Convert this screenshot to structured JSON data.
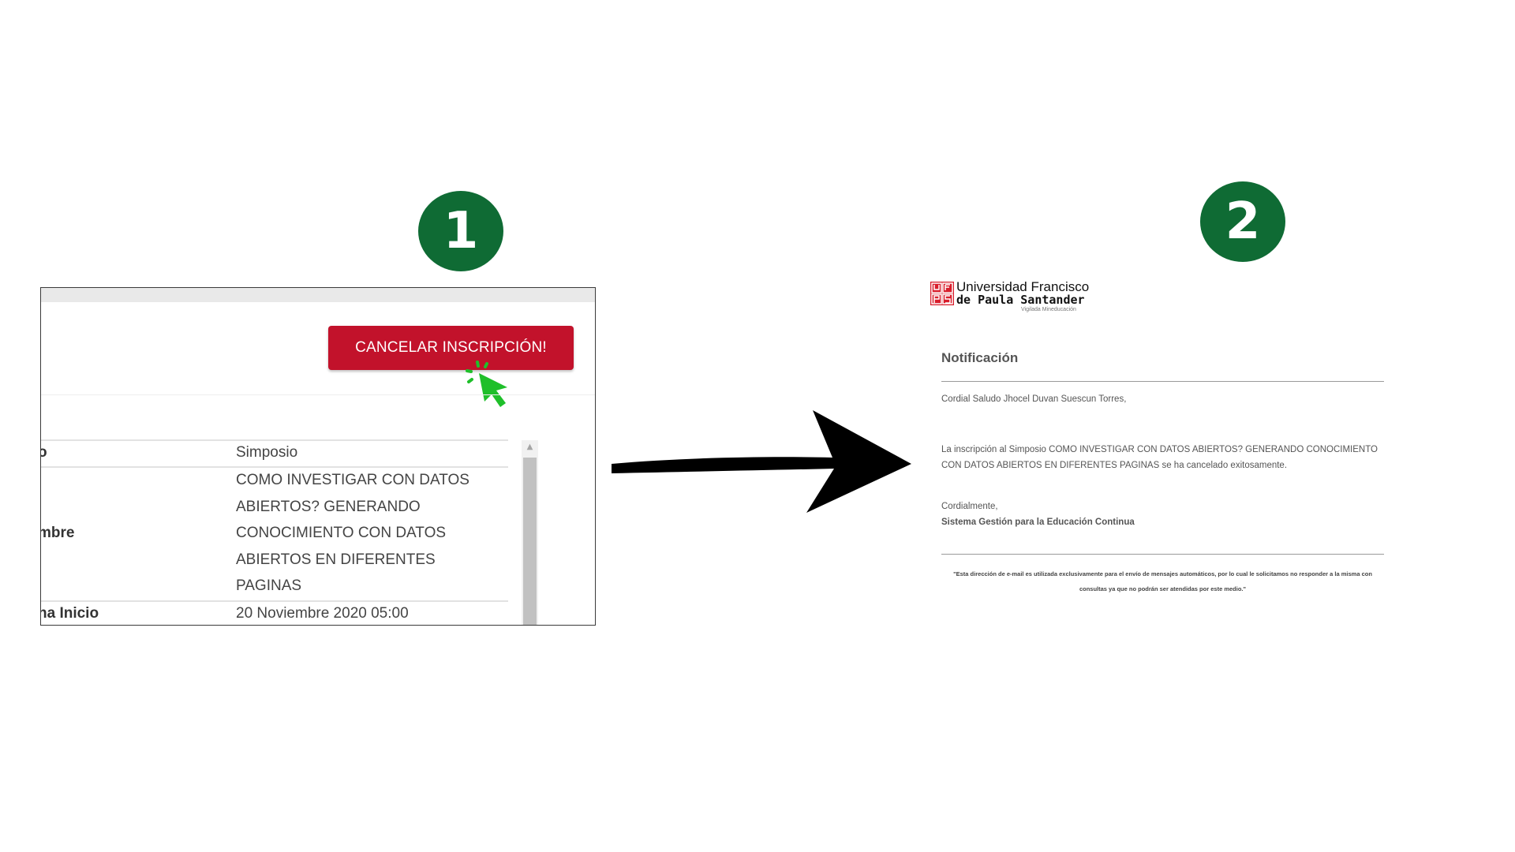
{
  "steps": {
    "step1": "1",
    "step2": "2"
  },
  "panel1": {
    "cancel_button_label": "CANCELAR INSCRIPCIÓN!",
    "rows": [
      {
        "label": "o",
        "value": "Simposio"
      },
      {
        "label": "mbre",
        "value": "COMO INVESTIGAR CON DATOS ABIERTOS? GENERANDO CONOCIMIENTO CON DATOS ABIERTOS EN DIFERENTES PAGINAS"
      },
      {
        "label": "ha Inicio",
        "value": "20 Noviembre 2020 05:00"
      }
    ]
  },
  "panel2": {
    "logo": {
      "mark": "UFPS",
      "line1": "Universidad Francisco",
      "line2": "de Paula Santander",
      "line3": "Vigilada Mineducación"
    },
    "title": "Notificación",
    "greeting": "Cordial Saludo Jhocel Duvan Suescun Torres,",
    "message": "La inscripción al Simposio COMO INVESTIGAR CON DATOS ABIERTOS? GENERANDO CONOCIMIENTO CON DATOS ABIERTOS EN DIFERENTES PAGINAS se ha cancelado exitosamente.",
    "closing": "Cordialmente,",
    "signature": "Sistema Gestión para la Educación Continua",
    "footer": "\"Esta dirección de e-mail es utilizada exclusivamente para el envío de mensajes automáticos, por lo cual le solicitamos no responder a la misma con consultas ya que no podrán ser atendidas por este medio.\""
  },
  "colors": {
    "badge": "#0f6b34",
    "cancel_button": "#c2122b",
    "cursor": "#1fbf2a"
  },
  "icons": {
    "cursor": "pointer-click-icon",
    "arrow": "right-arrow-icon"
  }
}
